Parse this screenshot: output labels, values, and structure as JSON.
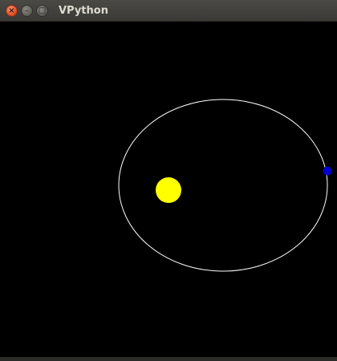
{
  "window": {
    "title": "VPython",
    "close_glyph": "×",
    "minimize_glyph": "–",
    "maximize_glyph": "□"
  },
  "scene": {
    "background_color": "#000000",
    "orbit_color": "#ffffff",
    "sun_color": "#ffff00",
    "planet_color": "#0000cc",
    "objects": [
      "orbit-path",
      "sun",
      "planet"
    ]
  }
}
